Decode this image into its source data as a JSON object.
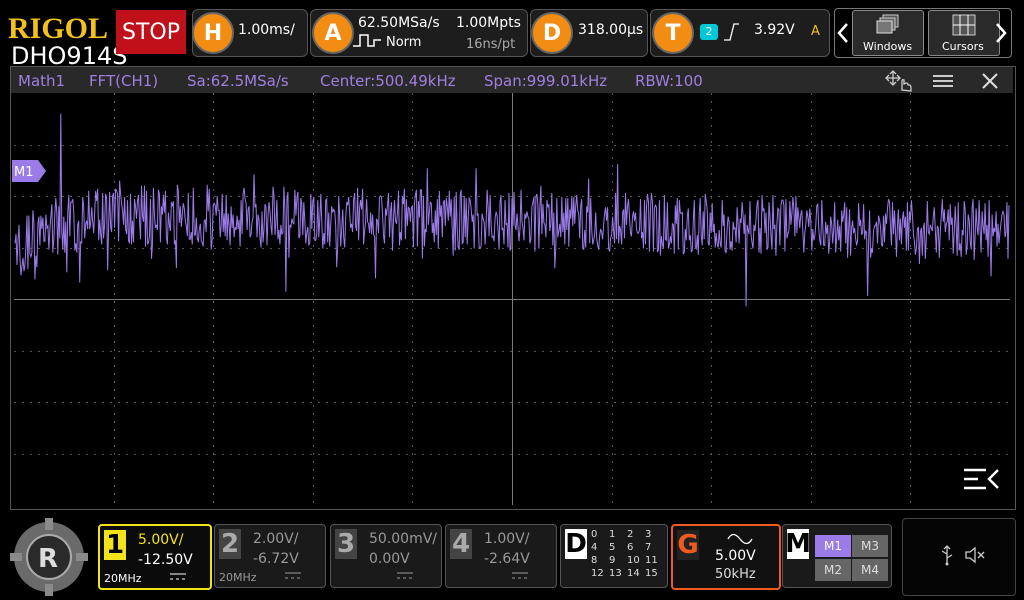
{
  "brand": {
    "logo": "RIGOL",
    "model": "DHO914S"
  },
  "run_state": {
    "label": "STOP"
  },
  "horizontal": {
    "letter": "H",
    "timebase": "1.00ms/"
  },
  "acquire": {
    "letter": "A",
    "sample_rate": "62.50MSa/s",
    "memory_depth": "1.00Mpts",
    "mode": "Norm",
    "resolution": "16ns/pt"
  },
  "delay": {
    "letter": "D",
    "value": "318.00μs"
  },
  "trigger": {
    "letter": "T",
    "source": "2",
    "slope_icon": "rising-edge-icon",
    "level": "3.92V",
    "sweep": "A"
  },
  "nav": {
    "prev_icon": "chevron-left-icon",
    "next_icon": "chevron-right-icon",
    "windows_label": "Windows",
    "cursors_label": "Cursors"
  },
  "math_window": {
    "name": "Math1",
    "source": "FFT(CH1)",
    "sample_rate": "Sa:62.5MSa/s",
    "center": "Center:500.49kHz",
    "span": "Span:999.01kHz",
    "rbw": "RBW:100",
    "marker": "M1"
  },
  "channels": [
    {
      "num": "1",
      "scale": "5.00V/",
      "offset": "-12.50V",
      "bw": "20MHz",
      "active": true,
      "color": "#f3e31a"
    },
    {
      "num": "2",
      "scale": "2.00V/",
      "offset": "-6.72V",
      "bw": "20MHz",
      "active": false,
      "color": "#888888"
    },
    {
      "num": "3",
      "scale": "50.00mV/",
      "offset": "0.00V",
      "bw": "",
      "active": false,
      "color": "#888888"
    },
    {
      "num": "4",
      "scale": "1.00V/",
      "offset": "-2.64V",
      "bw": "",
      "active": false,
      "color": "#888888"
    }
  ],
  "digital": {
    "letter": "D",
    "lines": [
      "0",
      "1",
      "2",
      "3",
      "4",
      "5",
      "6",
      "7",
      "8",
      "9",
      "10",
      "11",
      "12",
      "13",
      "14",
      "15"
    ]
  },
  "generator": {
    "letter": "G",
    "amplitude": "5.00V",
    "frequency": "50kHz",
    "wave_icon": "sine-wave-icon"
  },
  "math_menu": {
    "letter": "M",
    "items": [
      "M1",
      "M3",
      "M2",
      "M4"
    ]
  },
  "status_icons": {
    "usb": "usb-icon",
    "sound": "speaker-muted-icon"
  },
  "colors": {
    "trace": "#9b7be8",
    "accent": "#f28c12",
    "stop": "#c0101a",
    "ch1": "#f3e31a",
    "gen": "#f05a1e"
  },
  "chart_data": {
    "type": "line",
    "title": "",
    "xlabel": "",
    "ylabel": "",
    "x_range": [
      1,
      999
    ],
    "y_range": [
      0,
      400
    ],
    "series": [
      {
        "values": []
      }
    ]
  }
}
